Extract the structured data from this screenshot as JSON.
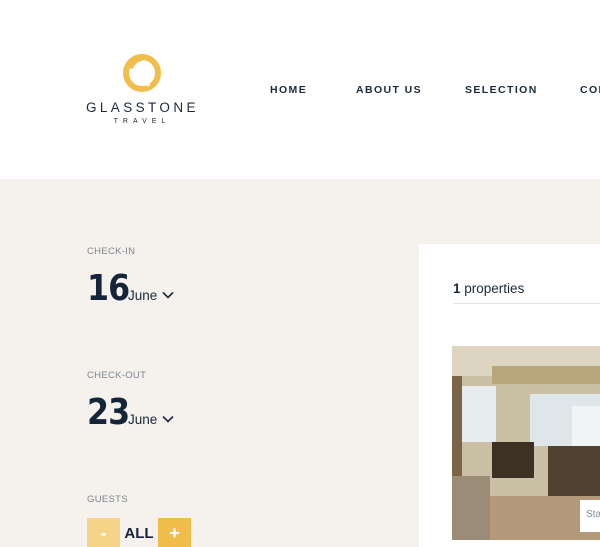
{
  "brand": {
    "name": "GLASSTONE",
    "sub": "TRAVEL",
    "accent_color": "#f1be4b",
    "text_color": "#1b2a3a",
    "background_color": "#f5f1ec"
  },
  "nav": {
    "items": [
      {
        "label": "HOME"
      },
      {
        "label": "ABOUT US"
      },
      {
        "label": "SELECTION"
      },
      {
        "label": "CON"
      }
    ]
  },
  "booking": {
    "checkin": {
      "label": "CHECK-IN",
      "day": "16",
      "month": "June"
    },
    "checkout": {
      "label": "CHECK-OUT",
      "day": "23",
      "month": "June"
    },
    "guests": {
      "label": "GUESTS",
      "value": "ALL",
      "minus": "-",
      "plus": "+"
    }
  },
  "results": {
    "count": "1",
    "count_label": "properties",
    "card_tag": "Sta"
  },
  "icons": {
    "logo": "glasstone-logo-icon",
    "chevron": "chevron-down-icon"
  }
}
